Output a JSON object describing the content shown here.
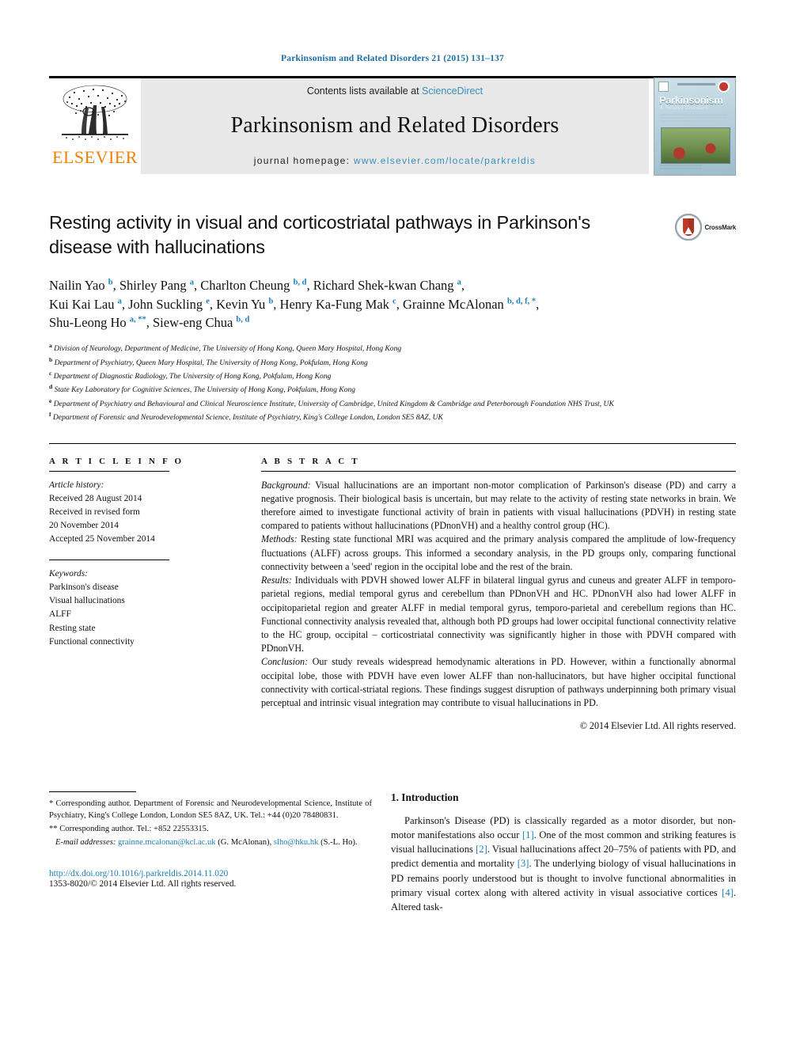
{
  "running_head": "Parkinsonism and Related Disorders 21 (2015) 131–137",
  "masthead": {
    "publisher": "ELSEVIER",
    "contents_prefix": "Contents lists available at ",
    "contents_link": "ScienceDirect",
    "journal_name": "Parkinsonism and Related Disorders",
    "homepage_prefix": "journal homepage: ",
    "homepage_url": "www.elsevier.com/locate/parkreldis",
    "cover": {
      "title": "Parkinsonism",
      "subtitle": "& Related Disorders"
    }
  },
  "article": {
    "title": "Resting activity in visual and corticostriatal pathways in Parkinson's disease with hallucinations",
    "crossmark_label": "CrossMark",
    "authors_line_1": "Nailin Yao <sup>b</sup>, Shirley Pang <sup>a</sup>, Charlton Cheung <sup>b, d</sup>, Richard Shek-kwan Chang <sup>a</sup>,",
    "authors_line_2": "Kui Kai Lau <sup>a</sup>, John Suckling <sup>e</sup>, Kevin Yu <sup>b</sup>, Henry Ka-Fung Mak <sup>c</sup>, Grainne McAlonan <sup>b, d, f, *</sup>,",
    "authors_line_3": "Shu-Leong Ho <sup>a, **</sup>, Siew-eng Chua <sup>b, d</sup>",
    "affiliations": [
      "<sup>a</sup> Division of Neurology, Department of Medicine, The University of Hong Kong, Queen Mary Hospital, Hong Kong",
      "<sup>b</sup> Department of Psychiatry, Queen Mary Hospital, The University of Hong Kong, Pokfulam, Hong Kong",
      "<sup>c</sup> Department of Diagnostic Radiology, The University of Hong Kong, Pokfulam, Hong Kong",
      "<sup>d</sup> State Key Laboratory for Cognitive Sciences, The University of Hong Kong, Pokfulam, Hong Kong",
      "<sup>e</sup> Department of Psychiatry and Behavioural and Clinical Neuroscience Institute, University of Cambridge, United Kingdom &amp; Cambridge and Peterborough Foundation NHS Trust, UK",
      "<sup>f</sup> Department of Forensic and Neurodevelopmental Science, Institute of Psychiatry, King's College London, London SE5 8AZ, UK"
    ]
  },
  "article_info": {
    "heading": "A R T I C L E  I N F O",
    "history_label": "Article history:",
    "history": [
      "Received 28 August 2014",
      "Received in revised form",
      "20 November 2014",
      "Accepted 25 November 2014"
    ],
    "keywords_label": "Keywords:",
    "keywords": [
      "Parkinson's disease",
      "Visual hallucinations",
      "ALFF",
      "Resting state",
      "Functional connectivity"
    ]
  },
  "abstract": {
    "heading": "A B S T R A C T",
    "paragraphs": [
      {
        "lead": "Background:",
        "text": " Visual hallucinations are an important non-motor complication of Parkinson's disease (PD) and carry a negative prognosis. Their biological basis is uncertain, but may relate to the activity of resting state networks in brain. We therefore aimed to investigate functional activity of brain in patients with visual hallucinations (PDVH) in resting state compared to patients without hallucinations (PDnonVH) and a healthy control group (HC)."
      },
      {
        "lead": "Methods:",
        "text": " Resting state functional MRI was acquired and the primary analysis compared the amplitude of low-frequency fluctuations (ALFF) across groups. This informed a secondary analysis, in the PD groups only, comparing functional connectivity between a 'seed' region in the occipital lobe and the rest of the brain."
      },
      {
        "lead": "Results:",
        "text": " Individuals with PDVH showed lower ALFF in bilateral lingual gyrus and cuneus and greater ALFF in temporo-parietal regions, medial temporal gyrus and cerebellum than PDnonVH and HC. PDnonVH also had lower ALFF in occipitoparietal region and greater ALFF in medial temporal gyrus, temporo-parietal and cerebellum regions than HC. Functional connectivity analysis revealed that, although both PD groups had lower occipital functional connectivity relative to the HC group, occipital – corticostriatal connectivity was significantly higher in those with PDVH compared with PDnonVH."
      },
      {
        "lead": "Conclusion:",
        "text": " Our study reveals widespread hemodynamic alterations in PD. However, within a functionally abnormal occipital lobe, those with PDVH have even lower ALFF than non-hallucinators, but have higher occipital functional connectivity with cortical-striatal regions. These findings suggest disruption of pathways underpinning both primary visual perceptual and intrinsic visual integration may contribute to visual hallucinations in PD."
      }
    ],
    "copyright": "© 2014 Elsevier Ltd. All rights reserved."
  },
  "footnotes": {
    "corresponding_1": "* Corresponding author. Department of Forensic and Neurodevelopmental Science, Institute of Psychiatry, King's College London, London SE5 8AZ, UK. Tel.: +44 (0)20 78480831.",
    "corresponding_2": "** Corresponding author. Tel.: +852 22553315.",
    "email_label": "E-mail addresses:",
    "email_1": "grainne.mcalonan@kcl.ac.uk",
    "email_1_owner": " (G. McAlonan), ",
    "email_2": "slho@hku.hk",
    "email_2_owner": " (S.-L. Ho)."
  },
  "publication": {
    "doi": "http://dx.doi.org/10.1016/j.parkreldis.2014.11.020",
    "issn_line": "1353-8020/© 2014 Elsevier Ltd. All rights reserved."
  },
  "introduction": {
    "heading": "1. Introduction",
    "text_parts": [
      "Parkinson's Disease (PD) is classically regarded as a motor disorder, but non-motor manifestations also occur ",
      "[1]",
      ". One of the most common and striking features is visual hallucinations ",
      "[2]",
      ". Visual hallucinations affect 20–75% of patients with PD, and predict dementia and mortality ",
      "[3]",
      ". The underlying biology of visual hallucinations in PD remains poorly understood but is thought to involve functional abnormalities in primary visual cortex along with altered activity in visual associative cortices ",
      "[4]",
      ". Altered task-"
    ]
  },
  "colors": {
    "link_blue": "#1a7fb5",
    "sciencedirect_blue": "#3a8fbf",
    "elsevier_orange": "#f08000",
    "band_grey": "#e8e8e8"
  }
}
